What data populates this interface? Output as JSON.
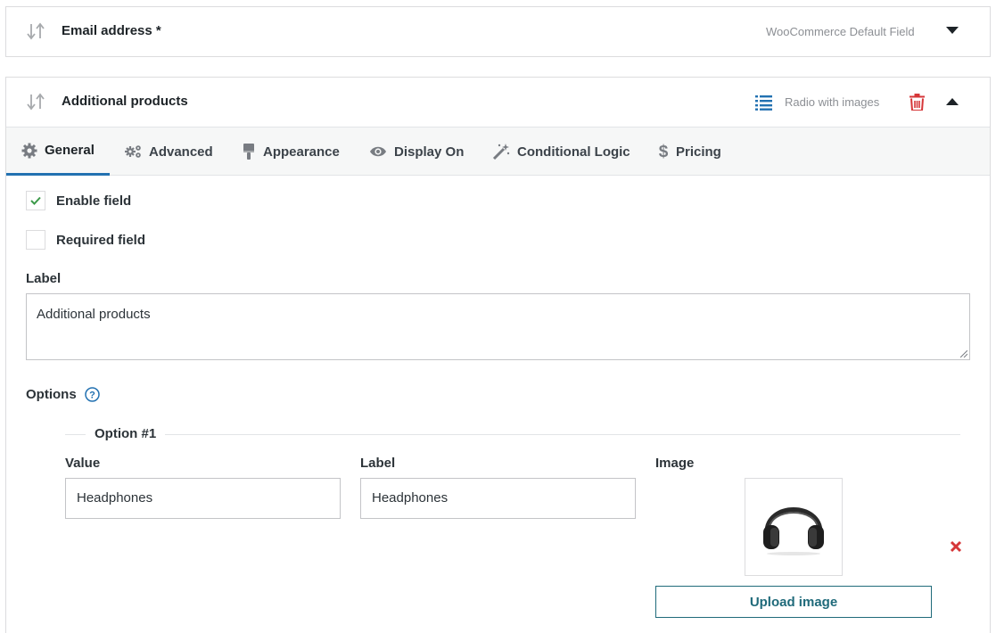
{
  "fields": {
    "email": {
      "title": "Email address *",
      "meta": "WooCommerce Default Field"
    },
    "additional": {
      "title": "Additional products",
      "type_label": "Radio with images",
      "tabs": [
        {
          "label": "General",
          "icon": "gear-icon"
        },
        {
          "label": "Advanced",
          "icon": "gears-icon"
        },
        {
          "label": "Appearance",
          "icon": "paintbrush-icon"
        },
        {
          "label": "Display On",
          "icon": "eye-icon"
        },
        {
          "label": "Conditional Logic",
          "icon": "magic-wand-icon"
        },
        {
          "label": "Pricing",
          "icon": "dollar-icon"
        }
      ],
      "enable_label": "Enable field",
      "enable_checked": true,
      "required_label": "Required field",
      "required_checked": false,
      "label_heading": "Label",
      "label_value": "Additional products",
      "options_heading": "Options",
      "option": {
        "legend": "Option #1",
        "value_heading": "Value",
        "value": "Headphones",
        "label_heading": "Label",
        "label": "Headphones",
        "image_heading": "Image",
        "image_icon": "headphones-image",
        "upload_label": "Upload image"
      }
    }
  },
  "colors": {
    "accent": "#2271b1",
    "danger": "#d63638",
    "check": "#3c9a4a",
    "teal": "#1f6a7a"
  }
}
